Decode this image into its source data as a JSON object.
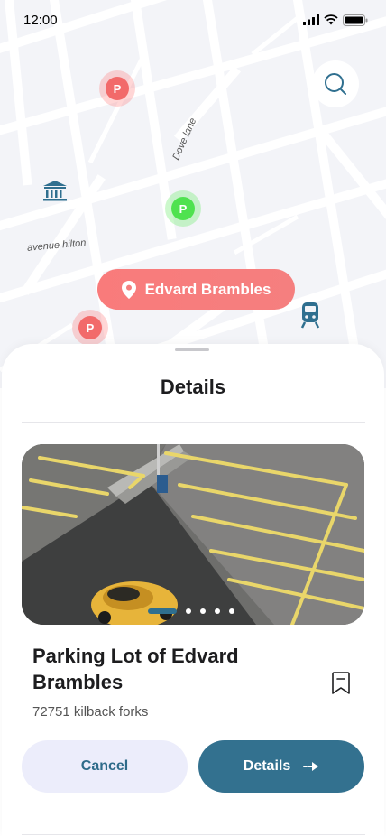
{
  "status_bar": {
    "time": "12:00",
    "signal_icon": "signal-bars-icon",
    "wifi_icon": "wifi-icon",
    "battery_icon": "battery-icon"
  },
  "map": {
    "search_icon": "search-icon",
    "street_labels": [
      "Dove lane",
      "avenue hilton"
    ],
    "parking_pins": [
      {
        "label": "P",
        "status": "unavailable",
        "color": "#f26a6a"
      },
      {
        "label": "P",
        "status": "available",
        "color": "#4fe24f"
      },
      {
        "label": "P",
        "status": "unavailable",
        "color": "#f26a6a"
      }
    ],
    "landmarks": [
      "bank-icon",
      "train-icon"
    ],
    "selected_location": {
      "label": "Edvard Brambles",
      "icon": "location-pin-icon"
    }
  },
  "sheet": {
    "title": "Details",
    "carousel": {
      "total": 5,
      "active": 1
    },
    "lot_name": "Parking Lot of Edvard Brambles",
    "address": "72751 kilback forks",
    "bookmark_icon": "bookmark-icon",
    "cancel_label": "Cancel",
    "details_label": "Details",
    "details_icon": "arrow-right-icon"
  },
  "colors": {
    "accent": "#33718f",
    "pill": "#f57f7f",
    "cancel_bg": "#ecedfb"
  }
}
